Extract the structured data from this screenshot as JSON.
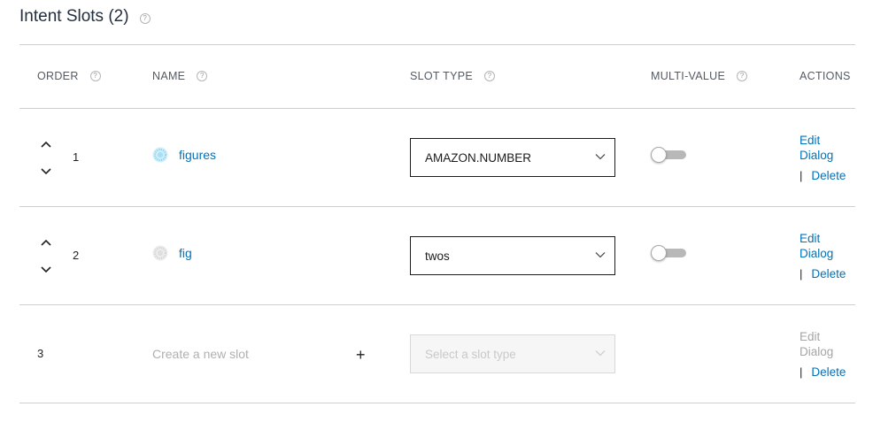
{
  "section": {
    "title": "Intent Slots (2)",
    "help_glyph": "?"
  },
  "table": {
    "headers": {
      "order": "ORDER",
      "name": "NAME",
      "slot_type": "SLOT TYPE",
      "multi_value": "MULTI-VALUE",
      "actions": "ACTIONS"
    },
    "rows": [
      {
        "order": "1",
        "name": "figures",
        "slot_type": "AMAZON.NUMBER",
        "multi_value": false,
        "edit_dialog": "Edit Dialog",
        "separator": "|",
        "delete": "Delete"
      },
      {
        "order": "2",
        "name": "fig",
        "slot_type": "twos",
        "multi_value": false,
        "edit_dialog": "Edit Dialog",
        "separator": "|",
        "delete": "Delete"
      }
    ],
    "new_row": {
      "order": "3",
      "name_placeholder": "Create a new slot",
      "add_glyph": "+",
      "slot_type_placeholder": "Select a slot type",
      "edit_dialog": "Edit Dialog",
      "separator": "|",
      "delete": "Delete"
    }
  },
  "colors": {
    "link": "#0073bb",
    "title": "#232f3e",
    "divider": "#cfcfcf",
    "icon_row1": "#8ed3ee",
    "icon_row2": "#d3d3d3"
  }
}
